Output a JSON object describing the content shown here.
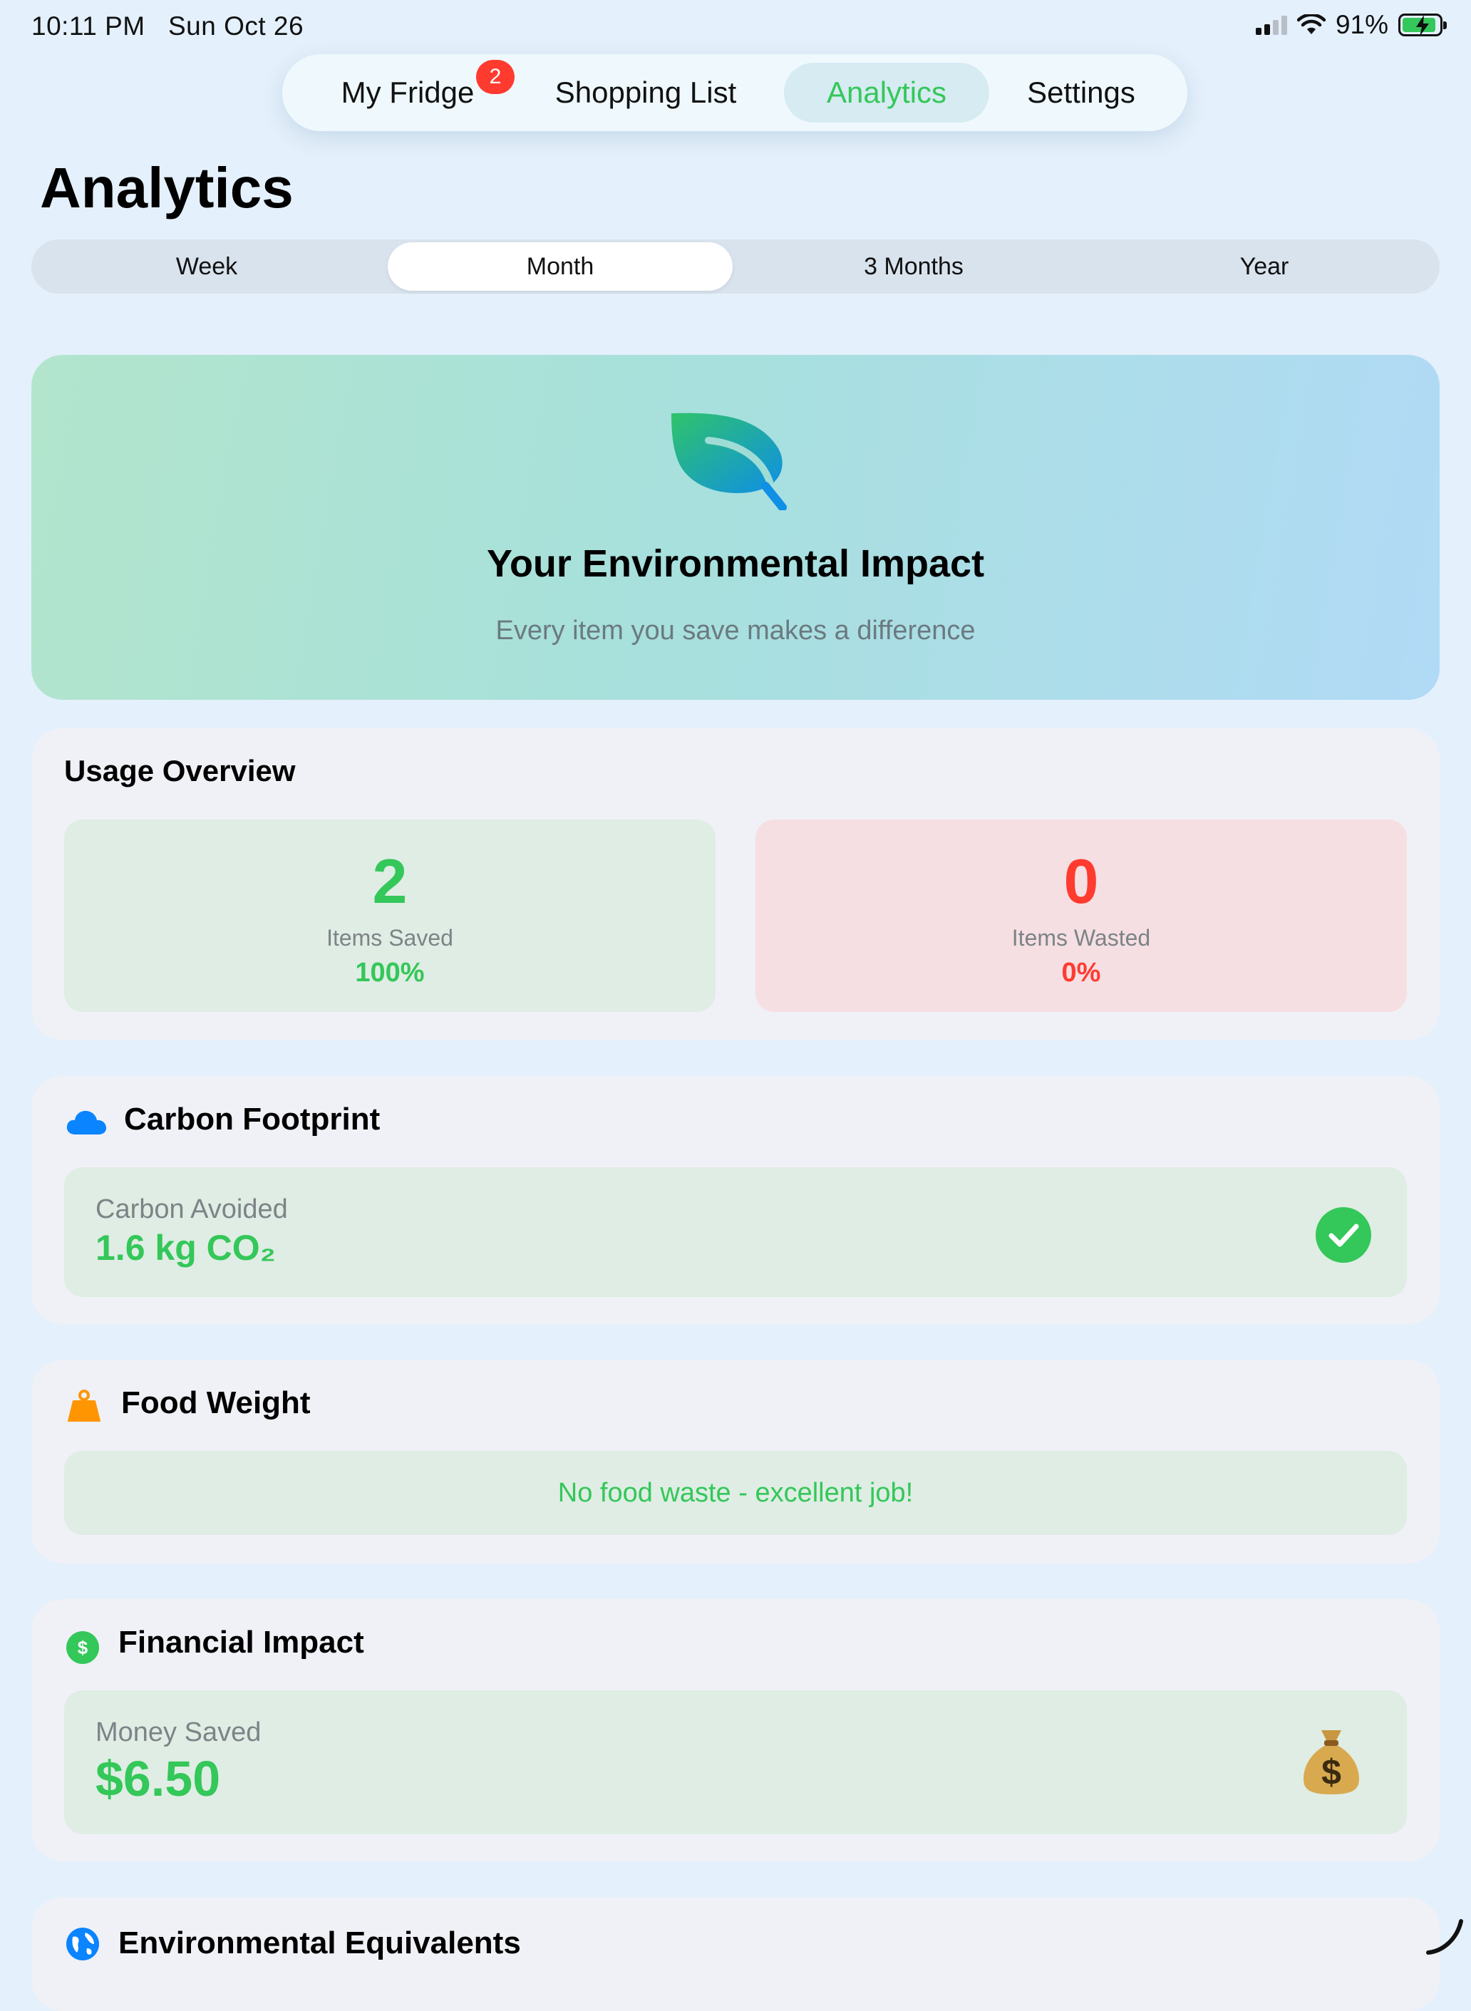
{
  "status_bar": {
    "time": "10:11 PM",
    "date": "Sun Oct 26",
    "battery": "91%",
    "battery_level": 0.91
  },
  "tabs": [
    {
      "label": "My Fridge",
      "badge": "2",
      "active": false
    },
    {
      "label": "Shopping List",
      "active": false
    },
    {
      "label": "Analytics",
      "active": true
    },
    {
      "label": "Settings",
      "active": false
    }
  ],
  "page": {
    "title": "Analytics"
  },
  "period": {
    "options": [
      "Week",
      "Month",
      "3 Months",
      "Year"
    ],
    "selected": "Month"
  },
  "hero": {
    "icon": "leaf-icon",
    "title": "Your Environmental Impact",
    "subtitle": "Every item you save makes a difference"
  },
  "usage": {
    "title": "Usage Overview",
    "saved": {
      "value": "2",
      "label": "Items Saved",
      "percent": "100%"
    },
    "wasted": {
      "value": "0",
      "label": "Items Wasted",
      "percent": "0%"
    }
  },
  "carbon": {
    "title": "Carbon Footprint",
    "icon": "cloud-icon",
    "label": "Carbon Avoided",
    "value": "1.6 kg CO₂",
    "status_icon": "checkmark-icon"
  },
  "food_weight": {
    "title": "Food Weight",
    "icon": "weight-icon",
    "message": "No food waste - excellent job!"
  },
  "financial": {
    "title": "Financial Impact",
    "icon": "dollar-icon",
    "label": "Money Saved",
    "value": "$6.50",
    "emoji_icon": "money-bag-icon"
  },
  "equivalents": {
    "title": "Environmental Equivalents",
    "icon": "globe-icon"
  },
  "colors": {
    "accent_green": "#34c759",
    "accent_red": "#ff3b30",
    "background": "#e4f0fb"
  }
}
